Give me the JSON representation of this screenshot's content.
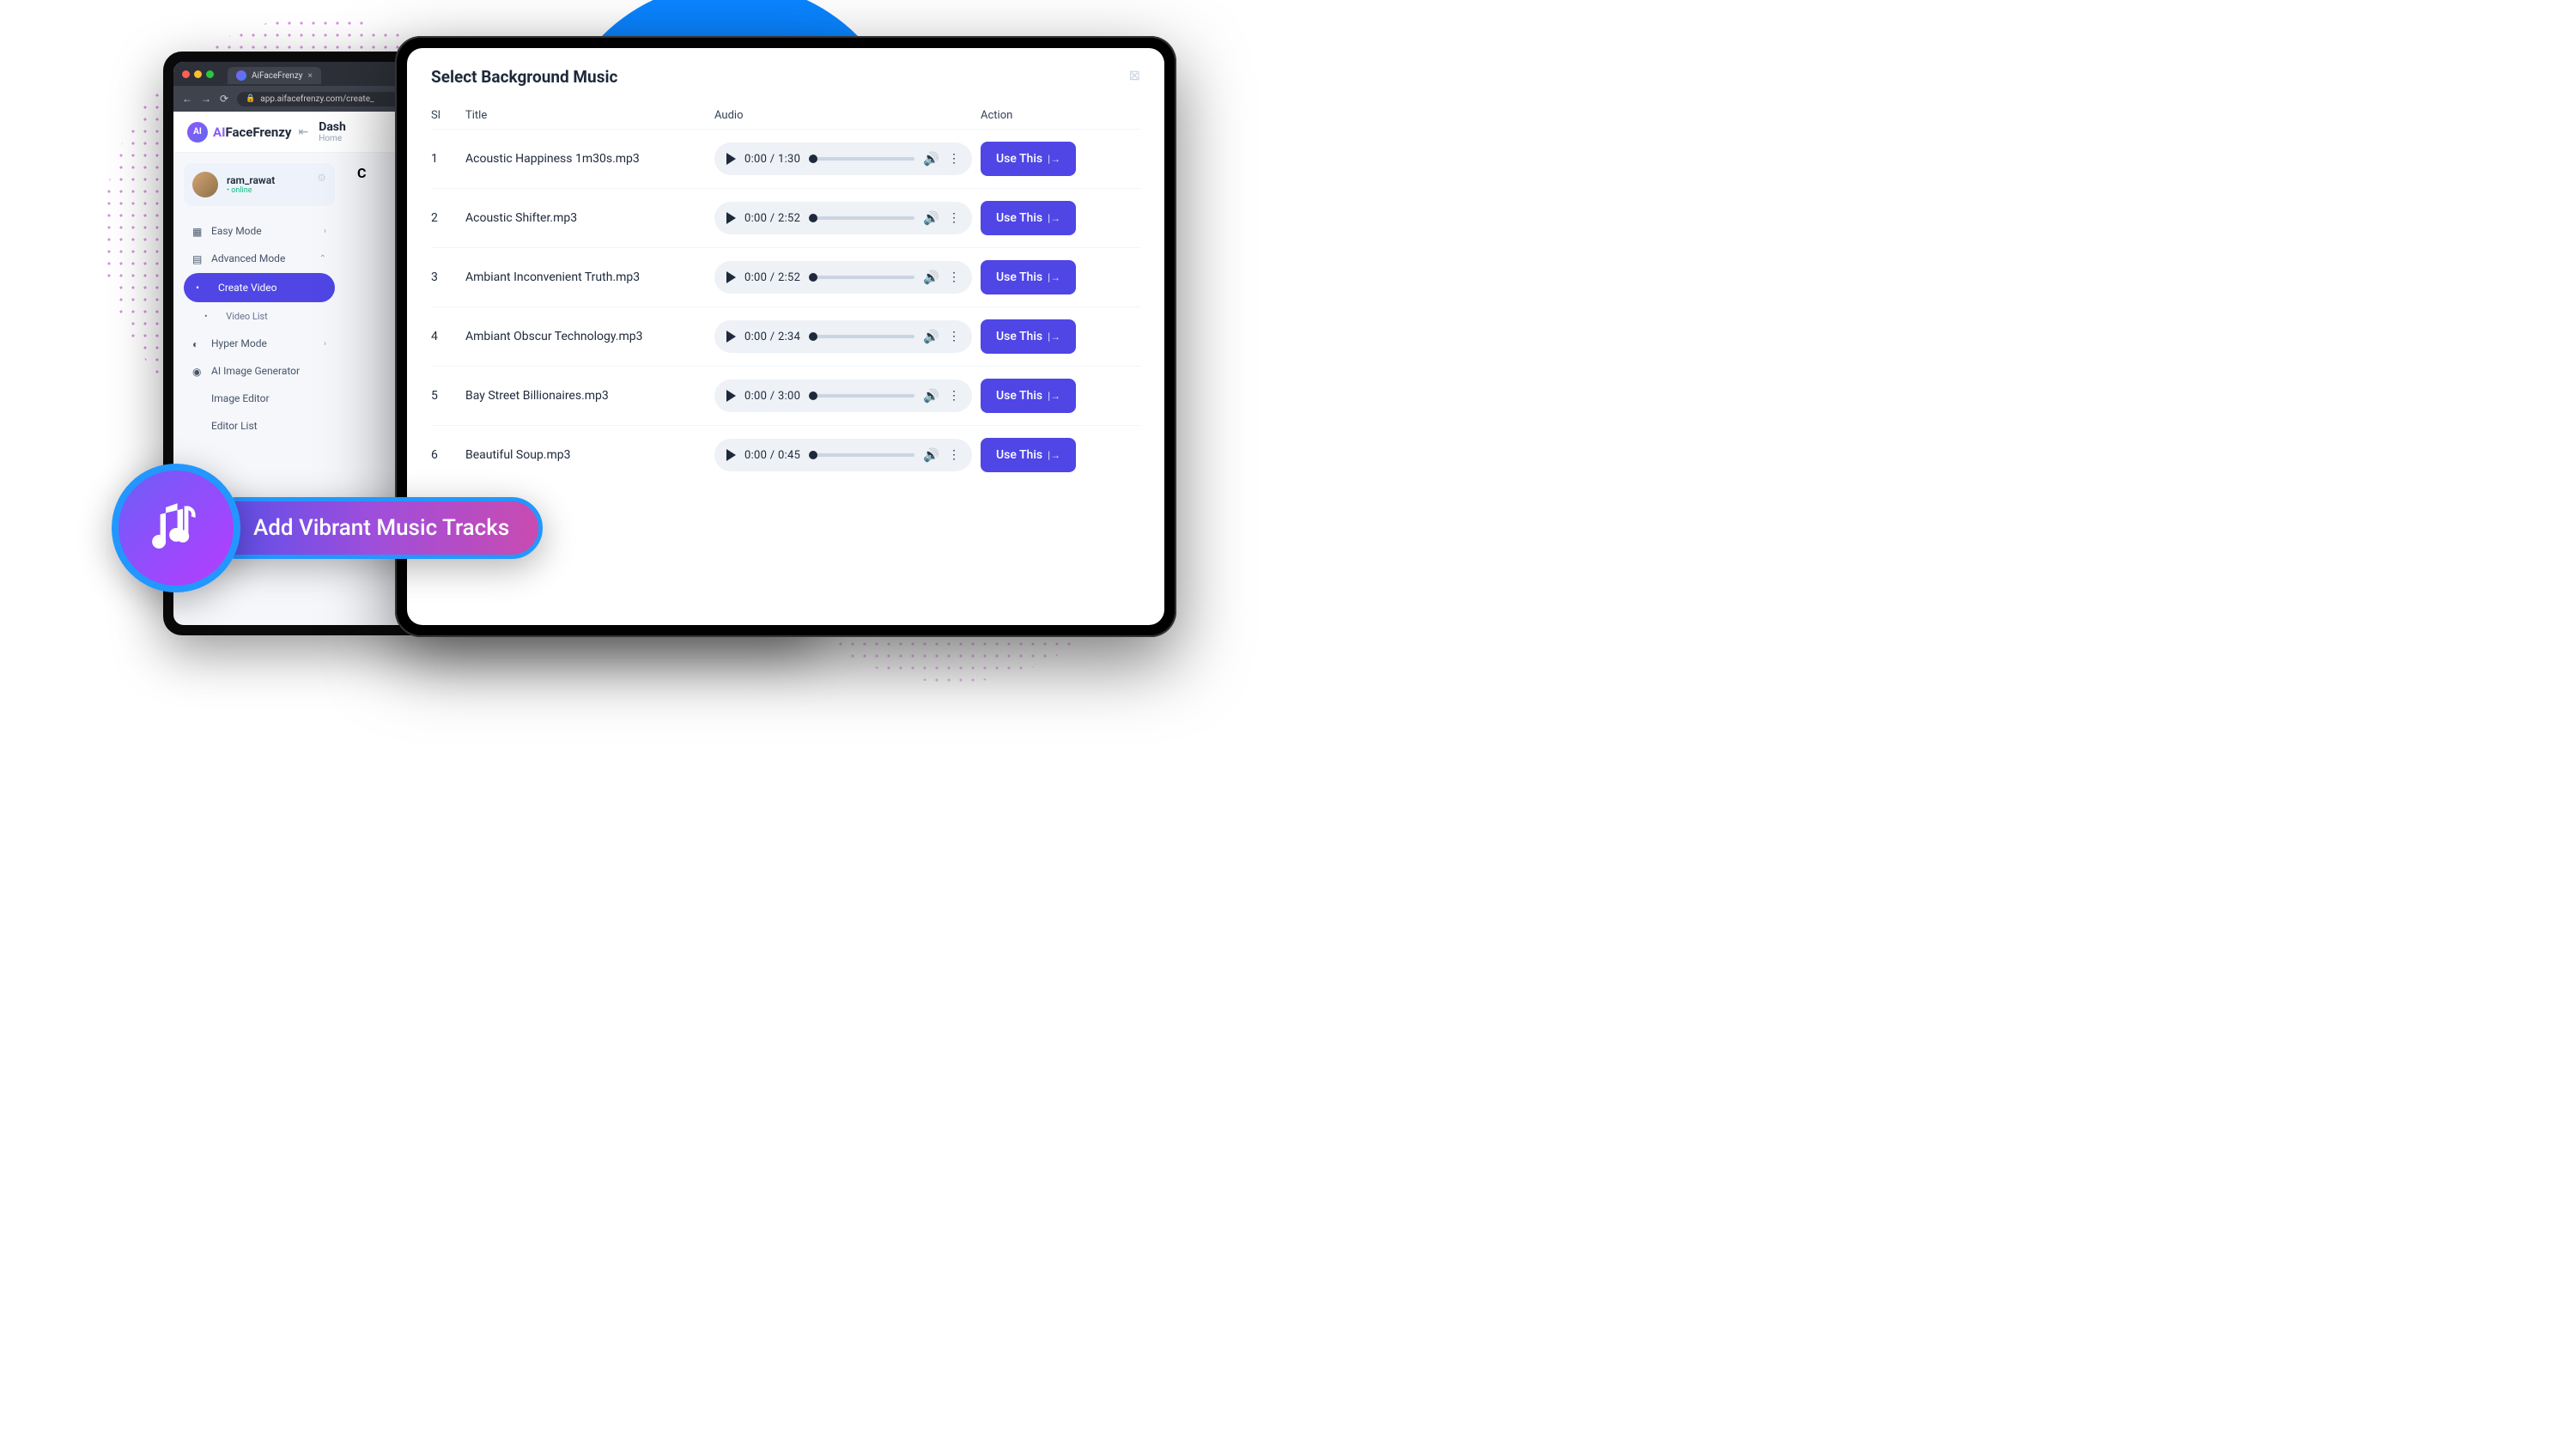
{
  "browser": {
    "tab_title": "AiFaceFrenzy",
    "url": "app.aifacefrenzy.com/create_"
  },
  "app": {
    "logo_ai": "AI",
    "logo_rest": "FaceFrenzy",
    "header_title": "Dash",
    "breadcrumb": "Home"
  },
  "user": {
    "name": "ram_rawat",
    "status": "• online"
  },
  "sidebar": {
    "items": [
      {
        "label": "Easy Mode",
        "expandable": true,
        "active": false
      },
      {
        "label": "Advanced Mode",
        "expandable": true,
        "expanded": true,
        "active": false
      },
      {
        "label": "Create Video",
        "active": true,
        "sub": true
      },
      {
        "label": "Video List",
        "active": false,
        "sub": true
      },
      {
        "label": "Hyper Mode",
        "expandable": true,
        "active": false
      },
      {
        "label": "AI Image Generator",
        "active": false
      },
      {
        "label": "Image Editor",
        "active": false
      },
      {
        "label": "Editor List",
        "active": false
      }
    ]
  },
  "modal": {
    "title": "Select Background Music",
    "columns": {
      "sl": "Sl",
      "title": "Title",
      "audio": "Audio",
      "action": "Action"
    },
    "use_label": "Use This",
    "tracks": [
      {
        "sl": "1",
        "title": "Acoustic Happiness 1m30s.mp3",
        "current": "0:00",
        "duration": "1:30"
      },
      {
        "sl": "2",
        "title": "Acoustic Shifter.mp3",
        "current": "0:00",
        "duration": "2:52"
      },
      {
        "sl": "3",
        "title": "Ambiant Inconvenient Truth.mp3",
        "current": "0:00",
        "duration": "2:52"
      },
      {
        "sl": "4",
        "title": "Ambiant Obscur Technology.mp3",
        "current": "0:00",
        "duration": "2:34"
      },
      {
        "sl": "5",
        "title": "Bay Street Billionaires.mp3",
        "current": "0:00",
        "duration": "3:00"
      },
      {
        "sl": "6",
        "title": "Beautiful Soup.mp3",
        "current": "0:00",
        "duration": "0:45"
      }
    ]
  },
  "overlay": {
    "badge_text": "Add Vibrant Music Tracks"
  },
  "main": {
    "heading_initial": "C"
  }
}
